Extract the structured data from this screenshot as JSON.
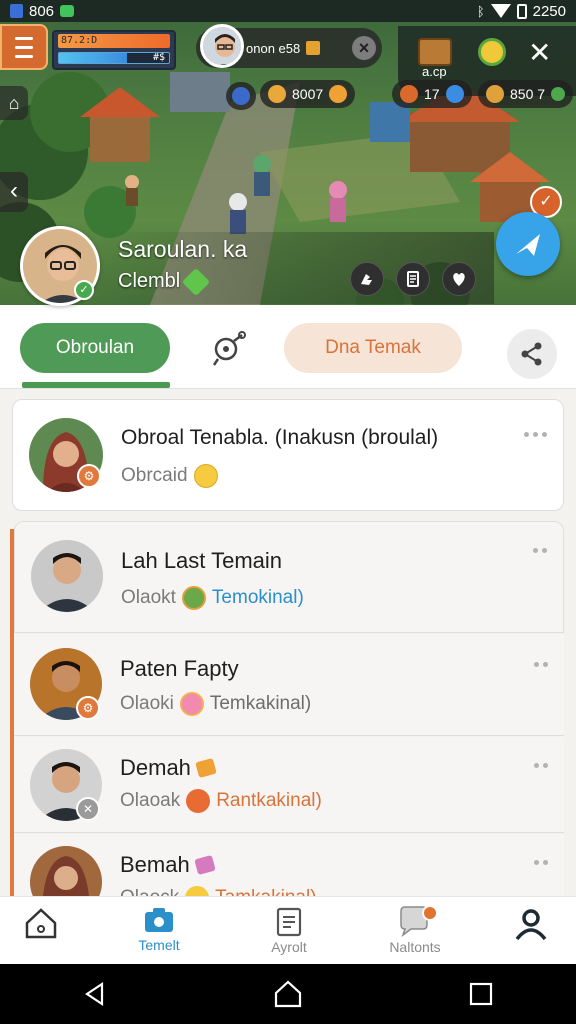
{
  "status_bar": {
    "left_text": "806",
    "time": "2250"
  },
  "game": {
    "hud_counter": "87.2:D",
    "hud_bar_label": "#$",
    "player_tag": "onon e58",
    "resource_1": "8007",
    "resource_2": "17",
    "resource_3": "850 7",
    "chest_label": "a.cp",
    "menu_icon": "hamburger-icon",
    "close_icon": "close-icon"
  },
  "profile": {
    "name": "Saroulan. ka",
    "status": "Clembl"
  },
  "tabs": {
    "primary": "Obroulan",
    "secondary": "Dna Temak"
  },
  "pinned": {
    "title": "Obroal Tenabla. (Inakusn (broulal)",
    "subtitle": "Obrcaid"
  },
  "chats": [
    {
      "name": "Lah Last Temain",
      "sub_prefix": "Olaokt",
      "sub_highlight": "Temokinal)",
      "highlight_color": "#2b8fc9"
    },
    {
      "name": "Paten Fapty",
      "sub_prefix": "Olaoki",
      "sub_highlight": "Temkakinal)",
      "highlight_color": "#6d6d6d"
    },
    {
      "name": "Demah",
      "sub_prefix": "Olaoak",
      "sub_highlight": "Rantkakinal)",
      "highlight_color": "#d9733a"
    },
    {
      "name": "Bemah",
      "sub_prefix": "Olaock",
      "sub_highlight": "Tamkakinal)",
      "highlight_color": "#d9733a"
    }
  ],
  "bottom_nav": [
    {
      "label": "",
      "icon": "home-icon"
    },
    {
      "label": "Temelt",
      "icon": "camera-icon"
    },
    {
      "label": "Ayrolt",
      "icon": "clipboard-icon"
    },
    {
      "label": "Naltonts",
      "icon": "notification-icon"
    },
    {
      "label": "",
      "icon": "profile-icon"
    }
  ],
  "colors": {
    "accent_green": "#4f9a56",
    "accent_blue": "#2b8fc9",
    "accent_orange": "#d9733a",
    "peach": "#f6e4d6",
    "fab_blue": "#37a3e8"
  }
}
